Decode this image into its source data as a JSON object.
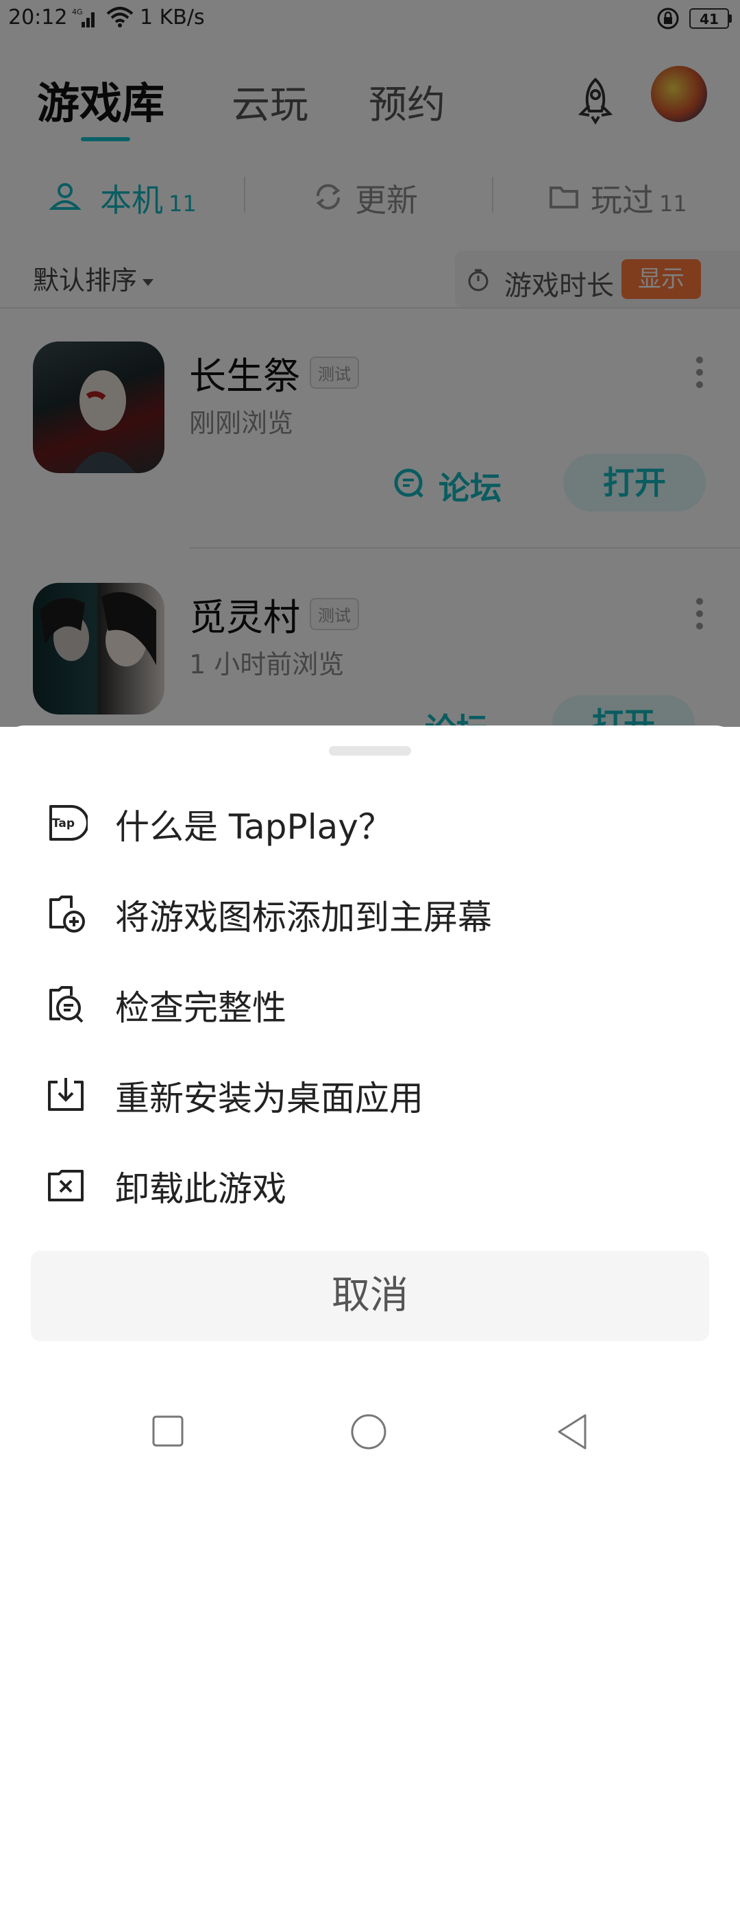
{
  "status_bar": {
    "time": "20:12",
    "network": "4G",
    "speed": "1 KB/s",
    "battery": "41"
  },
  "header": {
    "tabs": [
      {
        "label": "游戏库",
        "active": true
      },
      {
        "label": "云玩",
        "active": false
      },
      {
        "label": "预约",
        "active": false
      }
    ],
    "accent_color": "#15c5ce"
  },
  "sub_tabs": [
    {
      "label": "本机",
      "count": "11",
      "active": true,
      "icon": "device-icon"
    },
    {
      "label": "更新",
      "count": "",
      "active": false,
      "icon": "refresh-icon"
    },
    {
      "label": "玩过",
      "count": "11",
      "active": false,
      "icon": "folder-icon"
    }
  ],
  "sort": {
    "label": "默认排序"
  },
  "duration": {
    "label": "游戏时长",
    "button": "显示",
    "button_color": "#ff7a3d"
  },
  "games": [
    {
      "title": "长生祭",
      "tag": "测试",
      "subtitle": "刚刚浏览",
      "forum": "论坛",
      "open": "打开"
    },
    {
      "title": "觅灵村",
      "tag": "测试",
      "subtitle": "1 小时前浏览",
      "forum": "论坛",
      "open": "打开"
    }
  ],
  "sheet": {
    "items": [
      {
        "label": "什么是 TapPlay？",
        "icon": "tap-logo-icon"
      },
      {
        "label": "将游戏图标添加到主屏幕",
        "icon": "add-to-home-icon"
      },
      {
        "label": "检查完整性",
        "icon": "check-integrity-icon"
      },
      {
        "label": "重新安装为桌面应用",
        "icon": "download-install-icon"
      },
      {
        "label": "卸载此游戏",
        "icon": "uninstall-icon"
      }
    ],
    "tap_logo_text": "Tap",
    "cancel": "取消"
  },
  "nav": [
    "recent-apps-icon",
    "home-icon",
    "back-icon"
  ]
}
